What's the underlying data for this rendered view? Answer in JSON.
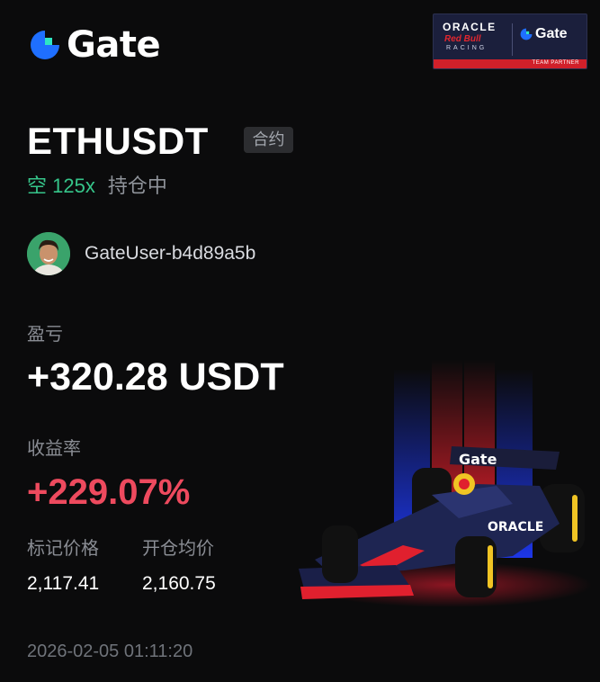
{
  "brand": {
    "name": "Gate",
    "accent": "#1f6fff"
  },
  "partner_badge": {
    "oracle": "ORACLE",
    "red_bull": "Red Bull",
    "racing": "RACING",
    "gate": "Gate",
    "footer": "TEAM PARTNER"
  },
  "position": {
    "pair": "ETHUSDT",
    "contract_tag": "合约",
    "side": "空 125x",
    "status": "持仓中"
  },
  "user": {
    "name": "GateUser-b4d89a5b",
    "avatar_icon": "avatar-icon"
  },
  "pnl": {
    "label": "盈亏",
    "value": "+320.28 USDT"
  },
  "return_rate": {
    "label": "收益率",
    "value": "+229.07%",
    "color": "#ee4a5e"
  },
  "mark_price": {
    "label": "标记价格",
    "value": "2,117.41"
  },
  "entry_price": {
    "label": "开仓均价",
    "value": "2,160.75"
  },
  "timestamp": "2026-02-05 01:11:20"
}
